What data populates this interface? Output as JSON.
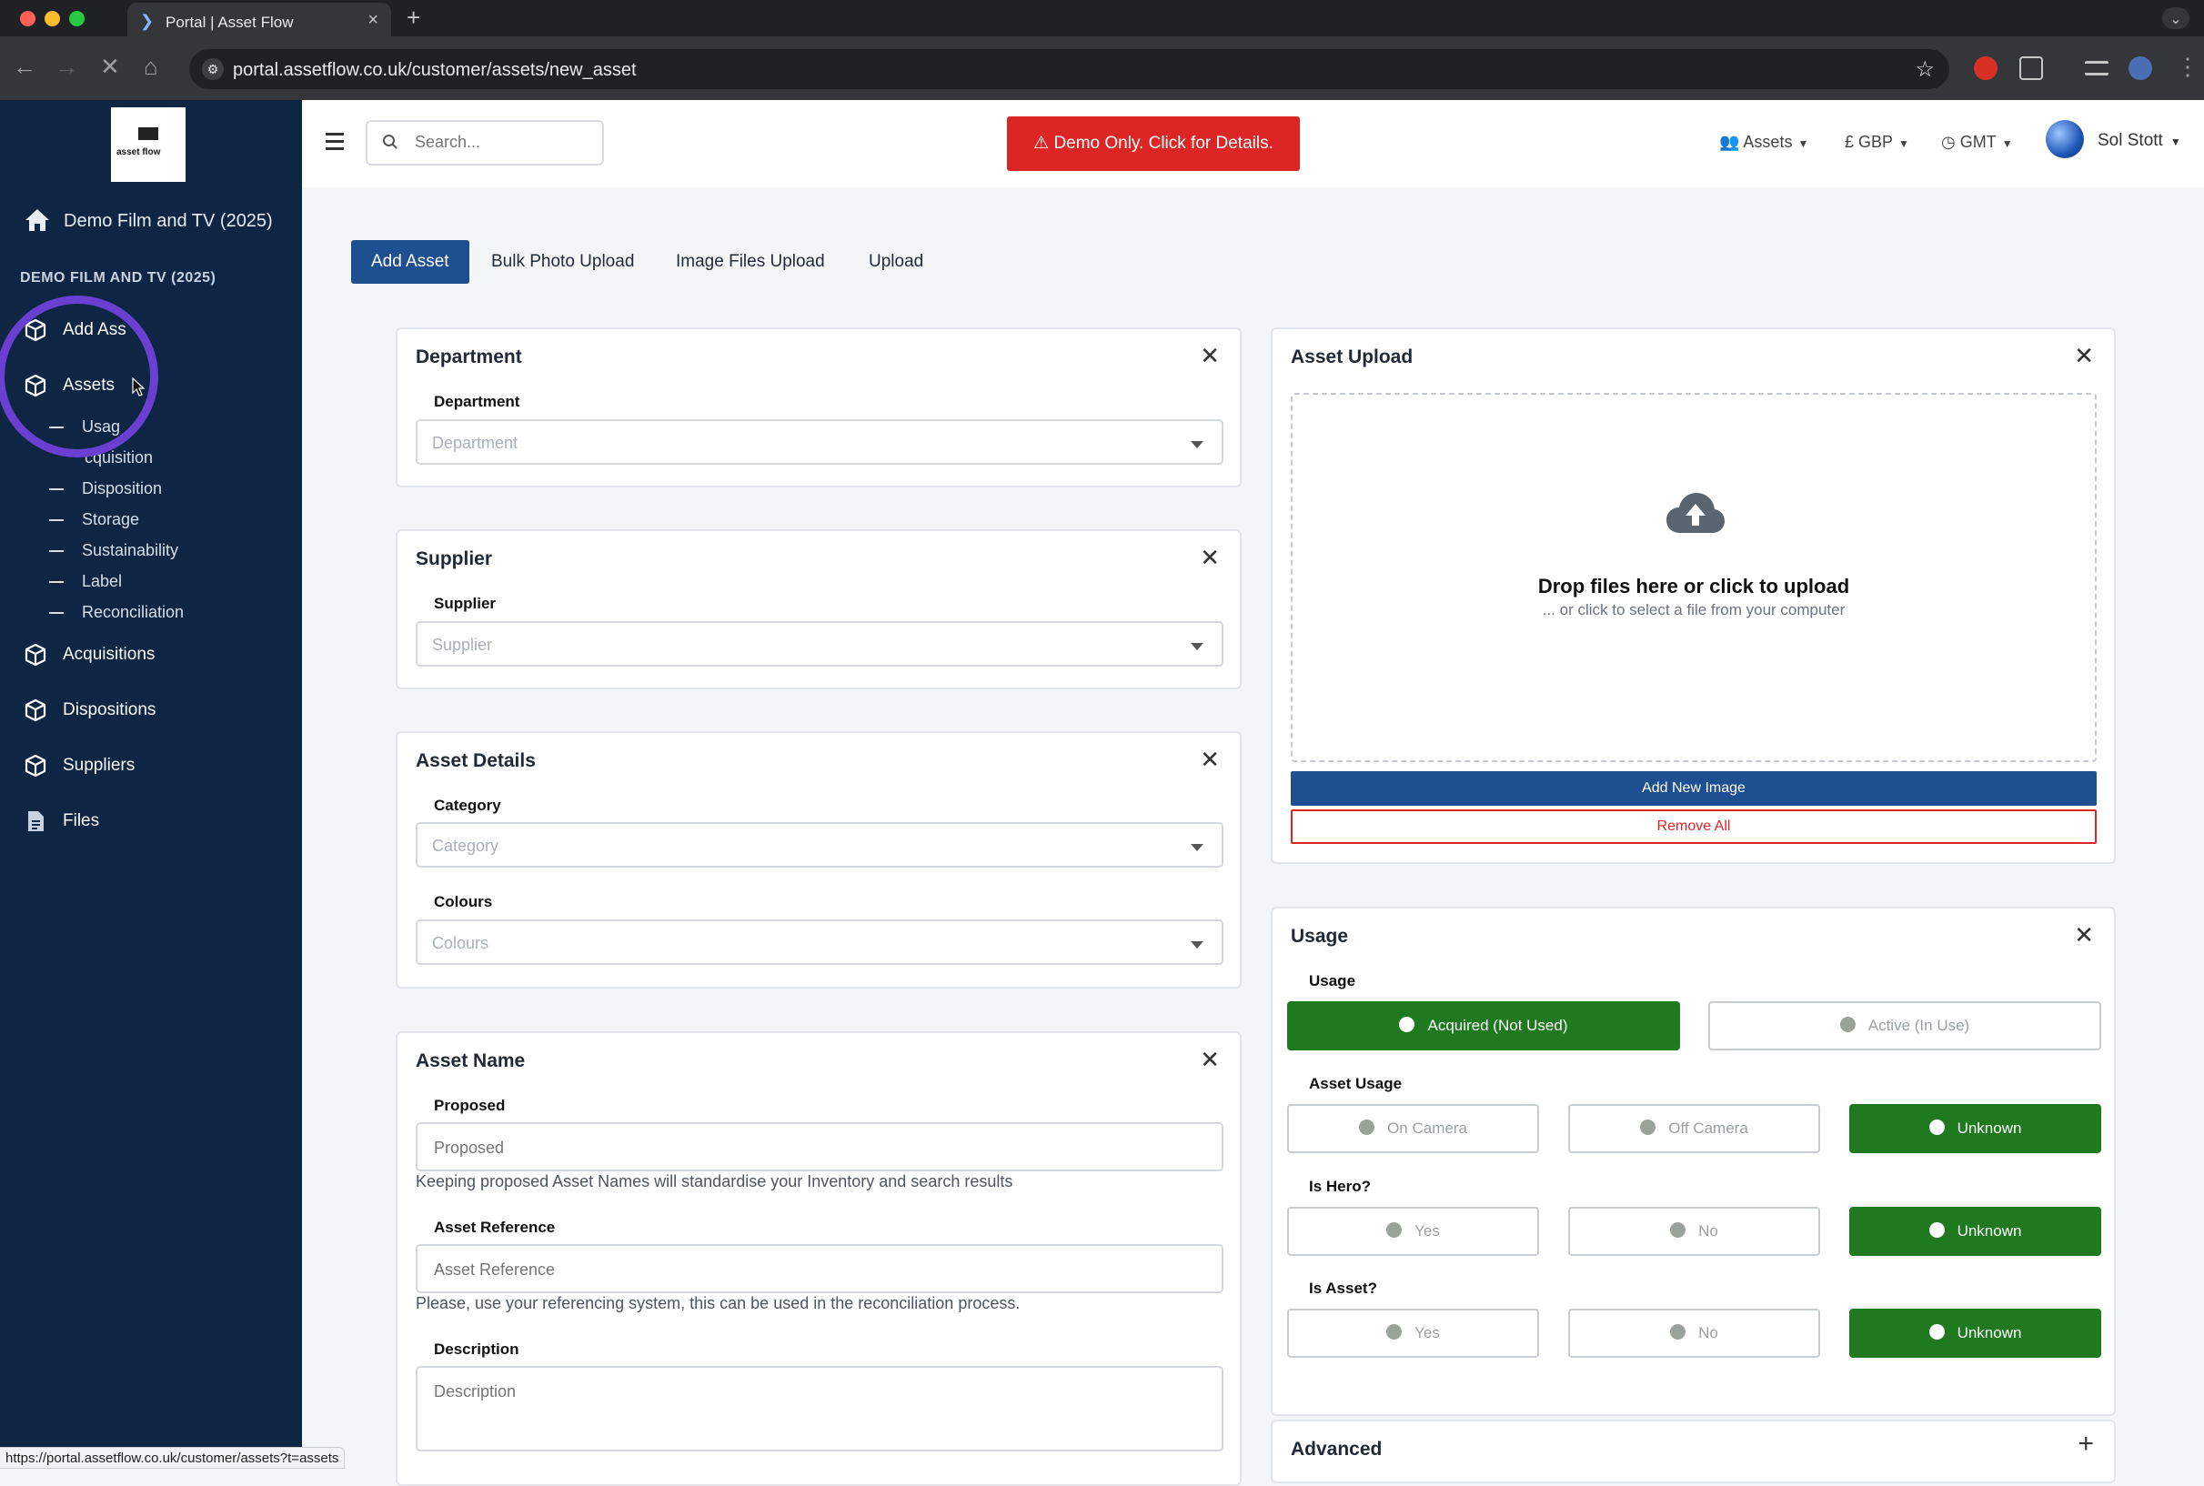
{
  "browser": {
    "tab_title": "Portal | Asset Flow",
    "url": "portal.assetflow.co.uk/customer/assets/new_asset",
    "status_url": "https://portal.assetflow.co.uk/customer/assets?t=assets"
  },
  "sidebar": {
    "logo_text": "asset flow",
    "org_link": "Demo Film and TV (2025)",
    "section_heading": "DEMO FILM AND TV (2025)",
    "items": [
      {
        "label": "Add Ass"
      },
      {
        "label": "Assets"
      },
      {
        "label": "Acquisitions"
      },
      {
        "label": "Dispositions"
      },
      {
        "label": "Suppliers"
      },
      {
        "label": "Files"
      }
    ],
    "sub_items": [
      {
        "label": "Usag"
      },
      {
        "label": "cquisition"
      },
      {
        "label": "Disposition"
      },
      {
        "label": "Storage"
      },
      {
        "label": "Sustainability"
      },
      {
        "label": "Label"
      },
      {
        "label": "Reconciliation"
      }
    ]
  },
  "header": {
    "search_placeholder": "Search...",
    "demo_button": "Demo Only. Click for Details.",
    "assets_menu": "Assets",
    "currency_menu": "£ GBP",
    "timezone_menu": "GMT",
    "user_name": "Sol Stott"
  },
  "subtabs": [
    "Add Asset",
    "Bulk Photo Upload",
    "Image Files Upload",
    "Upload"
  ],
  "department_card": {
    "title": "Department",
    "label": "Department",
    "placeholder": "Department"
  },
  "supplier_card": {
    "title": "Supplier",
    "label": "Supplier",
    "placeholder": "Supplier"
  },
  "details_card": {
    "title": "Asset Details",
    "category_label": "Category",
    "category_placeholder": "Category",
    "colours_label": "Colours",
    "colours_placeholder": "Colours"
  },
  "name_card": {
    "title": "Asset Name",
    "proposed_label": "Proposed",
    "proposed_placeholder": "Proposed",
    "proposed_help": "Keeping proposed Asset Names will standardise your Inventory and search results",
    "reference_label": "Asset Reference",
    "reference_placeholder": "Asset Reference",
    "reference_help": "Please, use your referencing system, this can be used in the reconciliation process.",
    "description_label": "Description",
    "description_placeholder": "Description"
  },
  "upload_card": {
    "title": "Asset Upload",
    "drop_title": "Drop files here or click to upload",
    "drop_sub": "... or click to select a file from your computer",
    "add_button": "Add New Image",
    "remove_button": "Remove All"
  },
  "usage_card": {
    "title": "Usage",
    "usage_label": "Usage",
    "usage_options": [
      "Acquired (Not Used)",
      "Active (In Use)"
    ],
    "asset_usage_label": "Asset Usage",
    "asset_usage_options": [
      "On Camera",
      "Off Camera",
      "Unknown"
    ],
    "hero_label": "Is Hero?",
    "hero_options": [
      "Yes",
      "No",
      "Unknown"
    ],
    "is_asset_label": "Is Asset?",
    "is_asset_options": [
      "Yes",
      "No",
      "Unknown"
    ]
  },
  "advanced_card": {
    "title": "Advanced"
  },
  "colors": {
    "sidebar_bg": "#0e2544",
    "primary": "#1d4f91",
    "demo_red": "#dc2626",
    "toggle_on": "#1f7a1f",
    "highlight_ring": "#6a3fd1"
  }
}
